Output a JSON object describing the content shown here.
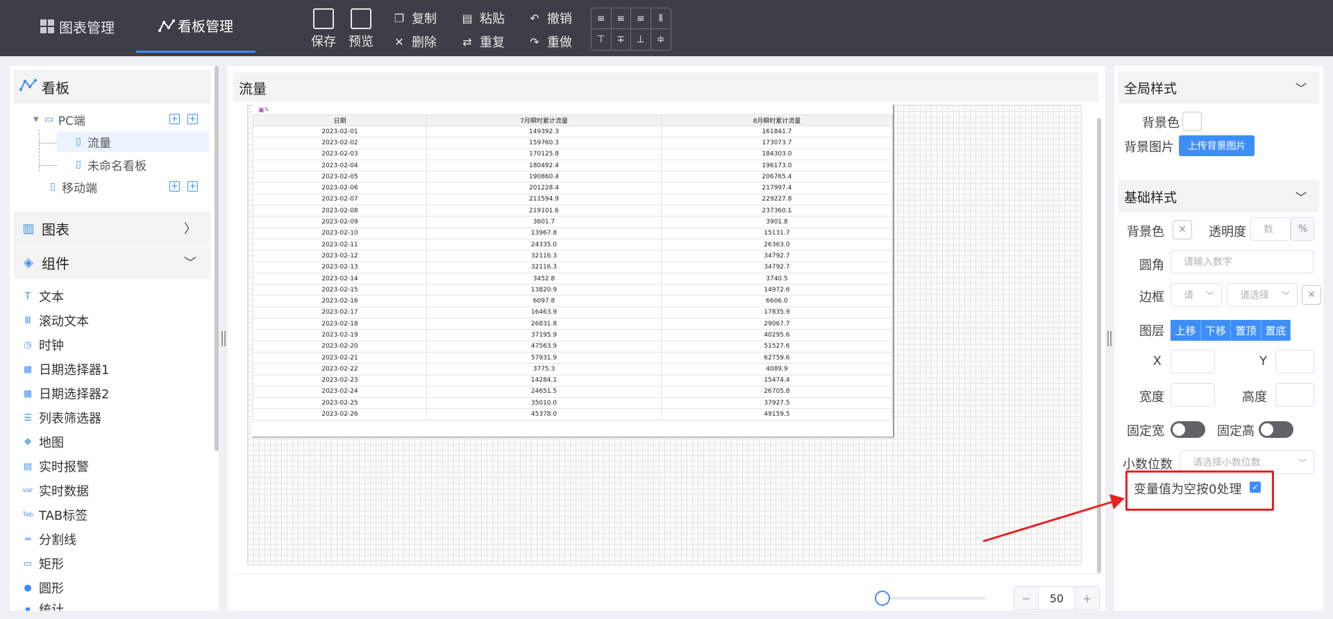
{
  "colors": {
    "accent": "#3e8ef7",
    "topbar": "#3c3f47",
    "highlight": "#e52222"
  },
  "tabs": [
    {
      "label": "图表管理",
      "icon": "grid-icon"
    },
    {
      "label": "看板管理",
      "icon": "graph-icon",
      "active": true
    }
  ],
  "toolbar": {
    "save": "保存",
    "preview": "预览",
    "copy": "复制",
    "paste": "粘贴",
    "undo": "撤销",
    "delete": "删除",
    "repeat": "重复",
    "redo": "重做"
  },
  "left": {
    "board_title": "看板",
    "tree": {
      "pc": "PC端",
      "items": [
        "流量",
        "未命名看板"
      ],
      "mobile": "移动端"
    },
    "chart_section": "图表",
    "component_section": "组件",
    "components": [
      "文本",
      "滚动文本",
      "时钟",
      "日期选择器1",
      "日期选择器2",
      "列表筛选器",
      "地图",
      "实时报警",
      "实时数据",
      "TAB标签",
      "分割线",
      "矩形",
      "圆形",
      "统计"
    ]
  },
  "center": {
    "title": "流量",
    "table": {
      "headers": [
        "日期",
        "7月瞬时累计流量",
        "8月瞬时累计流量"
      ],
      "rows": [
        [
          "2023-02-01",
          "149392.3",
          "161841.7"
        ],
        [
          "2023-02-02",
          "159760.3",
          "173073.7"
        ],
        [
          "2023-02-03",
          "170125.8",
          "184303.0"
        ],
        [
          "2023-02-04",
          "180492.4",
          "196173.0"
        ],
        [
          "2023-02-05",
          "190860.4",
          "206765.4"
        ],
        [
          "2023-02-06",
          "201228.4",
          "217997.4"
        ],
        [
          "2023-02-07",
          "211594.9",
          "229227.8"
        ],
        [
          "2023-02-08",
          "219101.6",
          "237360.1"
        ],
        [
          "2023-02-09",
          "3601.7",
          "3901.8"
        ],
        [
          "2023-02-10",
          "13967.8",
          "15131.7"
        ],
        [
          "2023-02-11",
          "24335.0",
          "26363.0"
        ],
        [
          "2023-02-12",
          "32116.3",
          "34792.7"
        ],
        [
          "2023-02-13",
          "32116.3",
          "34792.7"
        ],
        [
          "2023-02-14",
          "3452.8",
          "3740.5"
        ],
        [
          "2023-02-15",
          "13820.9",
          "14972.6"
        ],
        [
          "2023-02-16",
          "6097.8",
          "6606.0"
        ],
        [
          "2023-02-17",
          "16463.9",
          "17835.9"
        ],
        [
          "2023-02-18",
          "26831.8",
          "29067.7"
        ],
        [
          "2023-02-19",
          "37195.9",
          "40295.6"
        ],
        [
          "2023-02-20",
          "47563.9",
          "51527.6"
        ],
        [
          "2023-02-21",
          "57931.9",
          "62759.6"
        ],
        [
          "2023-02-22",
          "3775.3",
          "4089.9"
        ],
        [
          "2023-02-23",
          "14284.1",
          "15474.4"
        ],
        [
          "2023-02-24",
          "24651.5",
          "26705.8"
        ],
        [
          "2023-02-25",
          "35010.0",
          "37927.5"
        ],
        [
          "2023-02-26",
          "45378.0",
          "49159.5"
        ]
      ]
    },
    "zoom": {
      "value": "50",
      "minus": "−",
      "plus": "+",
      "level": 0
    }
  },
  "right": {
    "global_title": "全局样式",
    "bg_color_label": "背景色",
    "bg_image_label": "背景图片",
    "upload_bg": "上传背景图片",
    "base_title": "基础样式",
    "base_bg_label": "背景色",
    "opacity_label": "透明度",
    "opacity_placeholder": "数",
    "percent": "%",
    "radius_label": "圆角",
    "radius_placeholder": "请输入数字",
    "border_label": "边框",
    "border_ph1": "请",
    "border_ph2": "请选择",
    "layer_label": "图层",
    "layer_buttons": [
      "上移",
      "下移",
      "置顶",
      "置底"
    ],
    "x_label": "X",
    "y_label": "Y",
    "width_label": "宽度",
    "height_label": "高度",
    "fixed_w_label": "固定宽",
    "fixed_h_label": "固定高",
    "decimal_label": "小数位数",
    "decimal_placeholder": "请选择小数位数",
    "empty_zero_label": "变量值为空按0处理",
    "empty_zero_checked": true
  }
}
